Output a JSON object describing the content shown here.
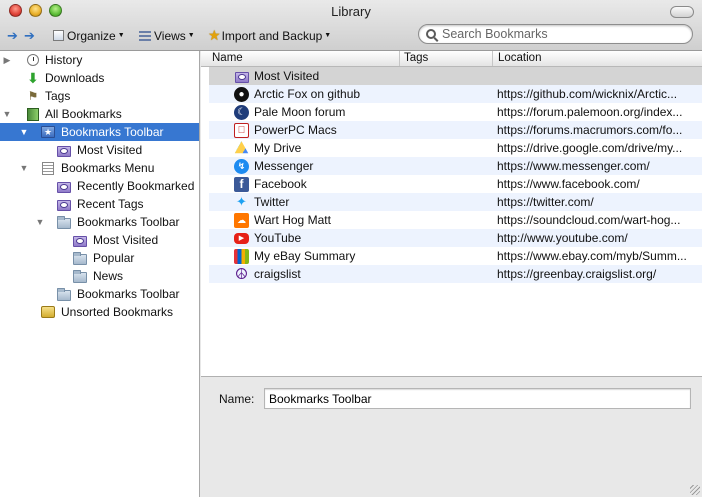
{
  "window": {
    "title": "Library"
  },
  "toolbar": {
    "organize_label": "Organize",
    "views_label": "Views",
    "import_label": "Import and Backup"
  },
  "search": {
    "placeholder": "Search Bookmarks",
    "value": ""
  },
  "sidebar": {
    "items": [
      {
        "label": "History",
        "icon": "clock-icon",
        "depth": 0,
        "disclosure": "collapsed"
      },
      {
        "label": "Downloads",
        "icon": "download-arrow-icon",
        "depth": 0,
        "disclosure": "none"
      },
      {
        "label": "Tags",
        "icon": "tag-icon",
        "depth": 0,
        "disclosure": "none"
      },
      {
        "label": "All Bookmarks",
        "icon": "bookmarks-book-icon",
        "depth": 0,
        "disclosure": "expanded"
      },
      {
        "label": "Bookmarks Toolbar",
        "icon": "toolbar-star-folder-icon",
        "depth": 1,
        "disclosure": "expanded",
        "selected": true
      },
      {
        "label": "Most Visited",
        "icon": "smart-folder-icon",
        "depth": 2,
        "disclosure": "none"
      },
      {
        "label": "Bookmarks Menu",
        "icon": "menu-list-icon",
        "depth": 1,
        "disclosure": "expanded"
      },
      {
        "label": "Recently Bookmarked",
        "icon": "smart-folder-icon",
        "depth": 2,
        "disclosure": "none"
      },
      {
        "label": "Recent Tags",
        "icon": "smart-folder-icon",
        "depth": 2,
        "disclosure": "none"
      },
      {
        "label": "Bookmarks Toolbar",
        "icon": "folder-icon",
        "depth": 2,
        "disclosure": "expanded"
      },
      {
        "label": "Most Visited",
        "icon": "smart-folder-icon",
        "depth": 3,
        "disclosure": "none"
      },
      {
        "label": "Popular",
        "icon": "folder-icon",
        "depth": 3,
        "disclosure": "none"
      },
      {
        "label": "News",
        "icon": "folder-icon",
        "depth": 3,
        "disclosure": "none"
      },
      {
        "label": "Bookmarks Toolbar",
        "icon": "folder-icon",
        "depth": 2,
        "disclosure": "none"
      },
      {
        "label": "Unsorted Bookmarks",
        "icon": "unsorted-bookmarks-icon",
        "depth": 1,
        "disclosure": "none"
      }
    ]
  },
  "table": {
    "columns": [
      "Name",
      "Tags",
      "Location"
    ],
    "rows": [
      {
        "name": "Most Visited",
        "tags": "",
        "location": "",
        "icon": "smart-folder-icon"
      },
      {
        "name": "Arctic Fox on github",
        "tags": "",
        "location": "https://github.com/wicknix/Arctic...",
        "icon": "github-icon"
      },
      {
        "name": "Pale Moon forum",
        "tags": "",
        "location": "https://forum.palemoon.org/index...",
        "icon": "pale-moon-icon"
      },
      {
        "name": "PowerPC Macs",
        "tags": "",
        "location": "https://forums.macrumors.com/fo...",
        "icon": "macrumors-icon"
      },
      {
        "name": "My Drive",
        "tags": "",
        "location": "https://drive.google.com/drive/my...",
        "icon": "google-drive-icon"
      },
      {
        "name": "Messenger",
        "tags": "",
        "location": "https://www.messenger.com/",
        "icon": "messenger-icon"
      },
      {
        "name": "Facebook",
        "tags": "",
        "location": "https://www.facebook.com/",
        "icon": "facebook-icon"
      },
      {
        "name": "Twitter",
        "tags": "",
        "location": "https://twitter.com/",
        "icon": "twitter-icon"
      },
      {
        "name": "Wart Hog Matt",
        "tags": "",
        "location": "https://soundcloud.com/wart-hog...",
        "icon": "soundcloud-icon"
      },
      {
        "name": "YouTube",
        "tags": "",
        "location": "http://www.youtube.com/",
        "icon": "youtube-icon"
      },
      {
        "name": "My eBay Summary",
        "tags": "",
        "location": "https://www.ebay.com/myb/Summ...",
        "icon": "ebay-icon"
      },
      {
        "name": "craigslist",
        "tags": "",
        "location": "https://greenbay.craigslist.org/",
        "icon": "craigslist-peace-icon"
      }
    ]
  },
  "details": {
    "name_label": "Name:",
    "name_value": "Bookmarks Toolbar"
  },
  "colors": {
    "selection": "#3777d1",
    "row_alt": "#edf3fe",
    "row_selected_inactive": "#d4d4d4"
  }
}
